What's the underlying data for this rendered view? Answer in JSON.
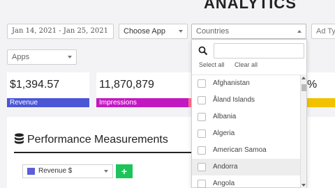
{
  "header": {
    "title": "ANALYTICS"
  },
  "filters": {
    "date_range": "Jan 14, 2021 - Jan 25, 2021",
    "app": "Choose App",
    "countries": "Countries",
    "ad_type": "Ad Typ",
    "apps": "Apps"
  },
  "cards": [
    {
      "value": "$1,394.57",
      "label": "Revenue",
      "color": "#4b56d6"
    },
    {
      "value": "11,870,879",
      "label": "Impressions",
      "color": "#c218c2"
    },
    {
      "value": "",
      "label": "",
      "color": "#ff6b8a"
    },
    {
      "value": "%",
      "label": "",
      "color": "#f2c200"
    }
  ],
  "performance": {
    "title": "Performance Measurements",
    "metric": "Revenue $",
    "metric_color": "#5b5fd8",
    "add_label": "+"
  },
  "country_dropdown": {
    "search_placeholder": "",
    "select_all": "Select all",
    "clear_all": "Clear all",
    "items": [
      "Afghanistan",
      "Åland Islands",
      "Albania",
      "Algeria",
      "American Samoa",
      "Andorra",
      "Angola"
    ],
    "highlighted_index": 5
  }
}
